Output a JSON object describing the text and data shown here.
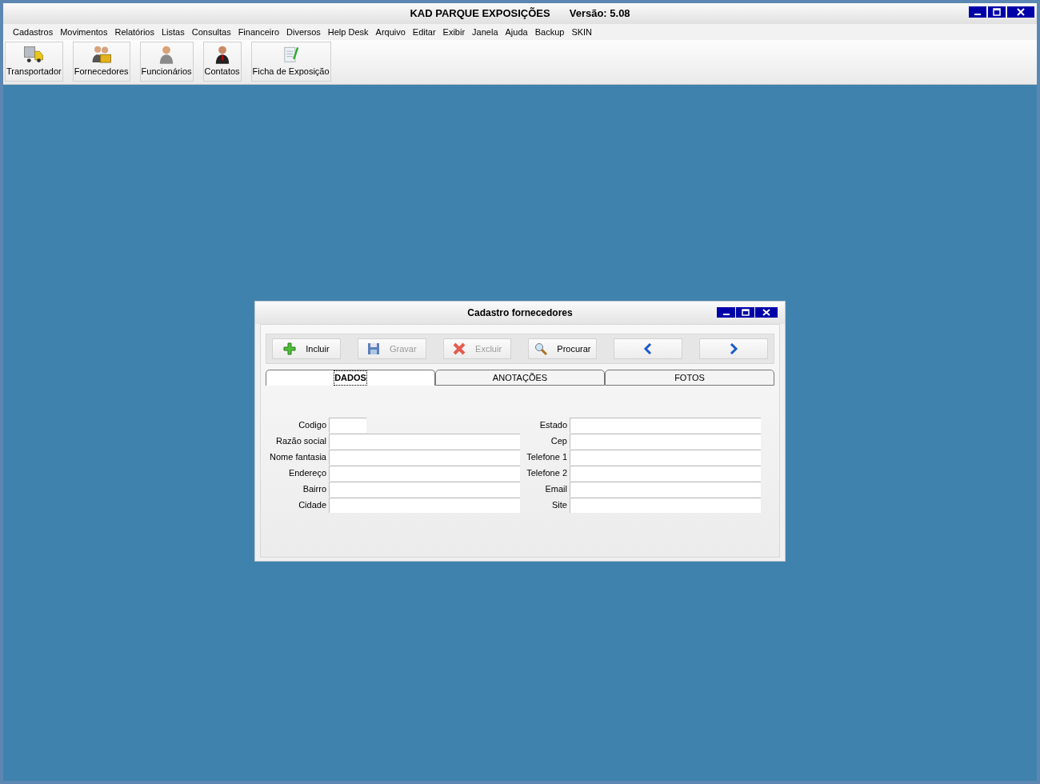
{
  "window": {
    "title": "KAD PARQUE EXPOSIÇÕES",
    "version": "Versão: 5.08"
  },
  "menu": [
    "Cadastros",
    "Movimentos",
    "Relatórios",
    "Listas",
    "Consultas",
    "Financeiro",
    "Diversos",
    "Help Desk",
    "Arquivo",
    "Editar",
    "Exibir",
    "Janela",
    "Ajuda",
    "Backup",
    "SKIN"
  ],
  "toolbar": [
    {
      "kind": "truck",
      "label": "Transportador"
    },
    {
      "kind": "people",
      "label": "Fornecedores"
    },
    {
      "kind": "person",
      "label": "Funcionários"
    },
    {
      "kind": "contact",
      "label": "Contatos"
    },
    {
      "kind": "form",
      "label": "Ficha de Exposição"
    }
  ],
  "dialog": {
    "title": "Cadastro fornecedores",
    "buttons": [
      {
        "kind": "add",
        "label": "Incluir",
        "disabled": false
      },
      {
        "kind": "save",
        "label": "Gravar",
        "disabled": true
      },
      {
        "kind": "delete",
        "label": "Excluir",
        "disabled": true
      },
      {
        "kind": "search",
        "label": "Procurar",
        "disabled": false
      },
      {
        "kind": "prev",
        "disabled": false
      },
      {
        "kind": "next",
        "disabled": false
      }
    ],
    "tabs": [
      {
        "label": "DADOS",
        "selected": true
      },
      {
        "label": "ANOTAÇÕES",
        "selected": false
      },
      {
        "label": "FOTOS",
        "selected": false
      }
    ],
    "left_fields": [
      {
        "label": "Codigo",
        "kind": "short"
      },
      {
        "label": "Razão social",
        "kind": "wide"
      },
      {
        "label": "Nome fantasia",
        "kind": "wide"
      },
      {
        "label": "Endereço",
        "kind": "wide"
      },
      {
        "label": "Bairro",
        "kind": "wide"
      },
      {
        "label": "Cidade",
        "kind": "wide"
      }
    ],
    "right_fields": [
      {
        "label": "Estado",
        "kind": "wide"
      },
      {
        "label": "Cep",
        "kind": "wide"
      },
      {
        "label": "Telefone 1",
        "kind": "wide"
      },
      {
        "label": "Telefone 2",
        "kind": "wide"
      },
      {
        "label": "Email",
        "kind": "wide"
      },
      {
        "label": "Site",
        "kind": "wide"
      }
    ]
  }
}
